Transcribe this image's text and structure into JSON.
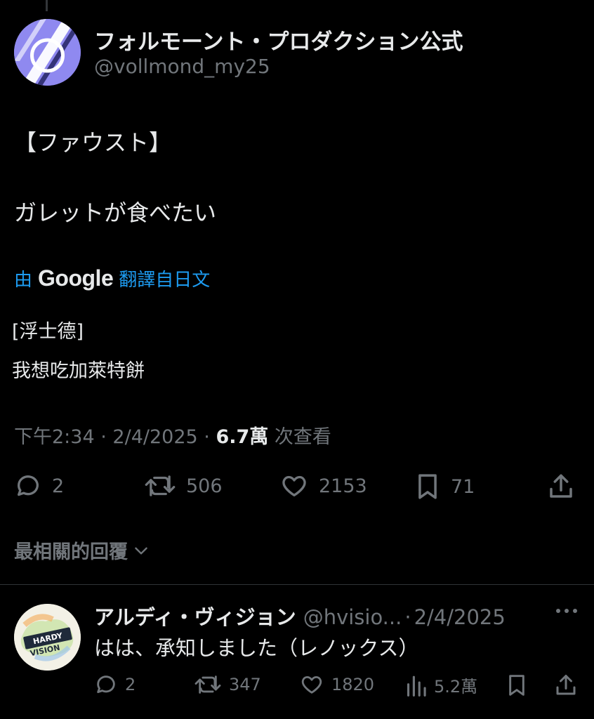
{
  "tweet": {
    "display_name": "フォルモーント・プロダクション公式",
    "handle": "@vollmond_my25",
    "text_line1": "【ファウスト】",
    "text_line2": "ガレットが食べたい",
    "translation": {
      "prefix": "由",
      "brand": "Google",
      "suffix": "翻譯自日文",
      "line1": "[浮士德]",
      "line2": "我想吃加萊特餅"
    },
    "meta": {
      "time": "下午2:34",
      "sep": "·",
      "date": "2/4/2025",
      "views": "6.7萬",
      "views_label": "次查看"
    },
    "actions": {
      "replies": "2",
      "reposts": "506",
      "likes": "2153",
      "bookmarks": "71"
    }
  },
  "replies_sort": {
    "label": "最相關的回覆"
  },
  "reply": {
    "display_name": "アルディ・ヴィジョン",
    "handle": "@hvisio...",
    "sep": "·",
    "date": "2/4/2025",
    "text": "はは、承知しました（レノックス）",
    "avatar_text": "HARDY VISION",
    "actions": {
      "replies": "2",
      "reposts": "347",
      "likes": "1820",
      "views": "5.2萬"
    }
  },
  "colors": {
    "background": "#000000",
    "text": "#e7e9ea",
    "muted": "#71767b",
    "link": "#1d9bf0",
    "divider": "#2f3336"
  }
}
